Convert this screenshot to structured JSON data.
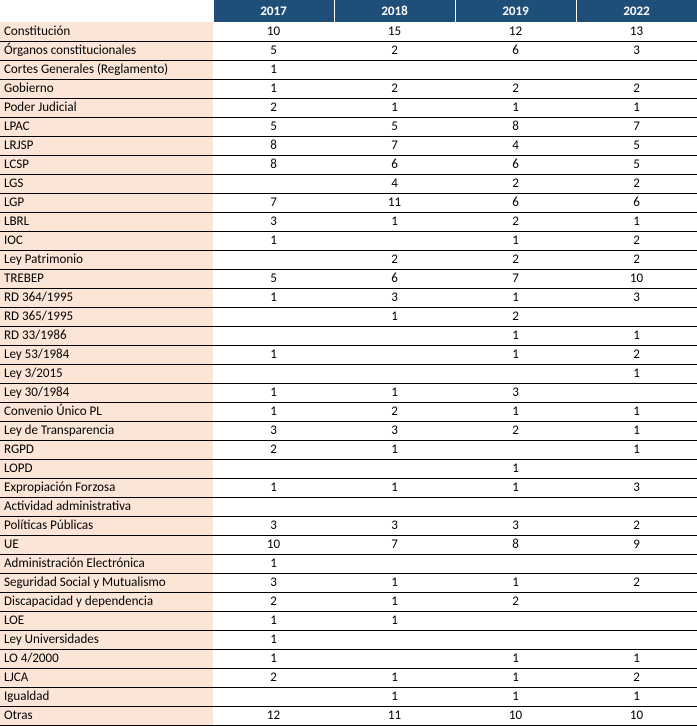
{
  "chart_data": {
    "type": "table",
    "columns": [
      "2017",
      "2018",
      "2019",
      "2022"
    ],
    "rows": [
      {
        "label": "Constitución",
        "values": [
          "10",
          "15",
          "12",
          "13"
        ]
      },
      {
        "label": "Órganos constitucionales",
        "values": [
          "5",
          "2",
          "6",
          "3"
        ]
      },
      {
        "label": "Cortes Generales (Reglamento)",
        "values": [
          "1",
          "",
          "",
          ""
        ]
      },
      {
        "label": "Gobierno",
        "values": [
          "1",
          "2",
          "2",
          "2"
        ]
      },
      {
        "label": "Poder Judicial",
        "values": [
          "2",
          "1",
          "1",
          "1"
        ]
      },
      {
        "label": "LPAC",
        "values": [
          "5",
          "5",
          "8",
          "7"
        ]
      },
      {
        "label": "LRJSP",
        "values": [
          "8",
          "7",
          "4",
          "5"
        ]
      },
      {
        "label": "LCSP",
        "values": [
          "8",
          "6",
          "6",
          "5"
        ]
      },
      {
        "label": "LGS",
        "values": [
          "",
          "4",
          "2",
          "2"
        ]
      },
      {
        "label": "LGP",
        "values": [
          "7",
          "11",
          "6",
          "6"
        ]
      },
      {
        "label": "LBRL",
        "values": [
          "3",
          "1",
          "2",
          "1"
        ]
      },
      {
        "label": "IOC",
        "values": [
          "1",
          "",
          "1",
          "2"
        ]
      },
      {
        "label": "Ley Patrimonio",
        "values": [
          "",
          "2",
          "2",
          "2"
        ]
      },
      {
        "label": "TREBEP",
        "values": [
          "5",
          "6",
          "7",
          "10"
        ]
      },
      {
        "label": "RD 364/1995",
        "values": [
          "1",
          "3",
          "1",
          "3"
        ]
      },
      {
        "label": "RD 365/1995",
        "values": [
          "",
          "1",
          "2",
          ""
        ]
      },
      {
        "label": "RD 33/1986",
        "values": [
          "",
          "",
          "1",
          "1"
        ]
      },
      {
        "label": "Ley 53/1984",
        "values": [
          "1",
          "",
          "1",
          "2"
        ]
      },
      {
        "label": "Ley 3/2015",
        "values": [
          "",
          "",
          "",
          "1"
        ]
      },
      {
        "label": "Ley 30/1984",
        "values": [
          "1",
          "1",
          "3",
          ""
        ]
      },
      {
        "label": "Convenio Único PL",
        "values": [
          "1",
          "2",
          "1",
          "1"
        ]
      },
      {
        "label": "Ley de Transparencia",
        "values": [
          "3",
          "3",
          "2",
          "1"
        ]
      },
      {
        "label": "RGPD",
        "values": [
          "2",
          "1",
          "",
          "1"
        ]
      },
      {
        "label": "LOPD",
        "values": [
          "",
          "",
          "1",
          ""
        ]
      },
      {
        "label": "Expropiación Forzosa",
        "values": [
          "1",
          "1",
          "1",
          "3"
        ]
      },
      {
        "label": "Actividad administrativa",
        "values": [
          "",
          "",
          "",
          ""
        ]
      },
      {
        "label": "Políticas Públicas",
        "values": [
          "3",
          "3",
          "3",
          "2"
        ]
      },
      {
        "label": "UE",
        "values": [
          "10",
          "7",
          "8",
          "9"
        ]
      },
      {
        "label": "Administración Electrónica",
        "values": [
          "1",
          "",
          "",
          ""
        ]
      },
      {
        "label": "Seguridad Social y Mutualismo",
        "values": [
          "3",
          "1",
          "1",
          "2"
        ]
      },
      {
        "label": "Discapacidad y dependencia",
        "values": [
          "2",
          "1",
          "2",
          ""
        ]
      },
      {
        "label": "LOE",
        "values": [
          "1",
          "1",
          "",
          ""
        ]
      },
      {
        "label": "Ley Universidades",
        "values": [
          "1",
          "",
          "",
          ""
        ]
      },
      {
        "label": "LO 4/2000",
        "values": [
          "1",
          "",
          "1",
          "1"
        ]
      },
      {
        "label": "LJCA",
        "values": [
          "2",
          "1",
          "1",
          "2"
        ]
      },
      {
        "label": "Igualdad",
        "values": [
          "",
          "1",
          "1",
          "1"
        ]
      },
      {
        "label": "Otras",
        "values": [
          "12",
          "11",
          "10",
          "10"
        ]
      }
    ]
  }
}
